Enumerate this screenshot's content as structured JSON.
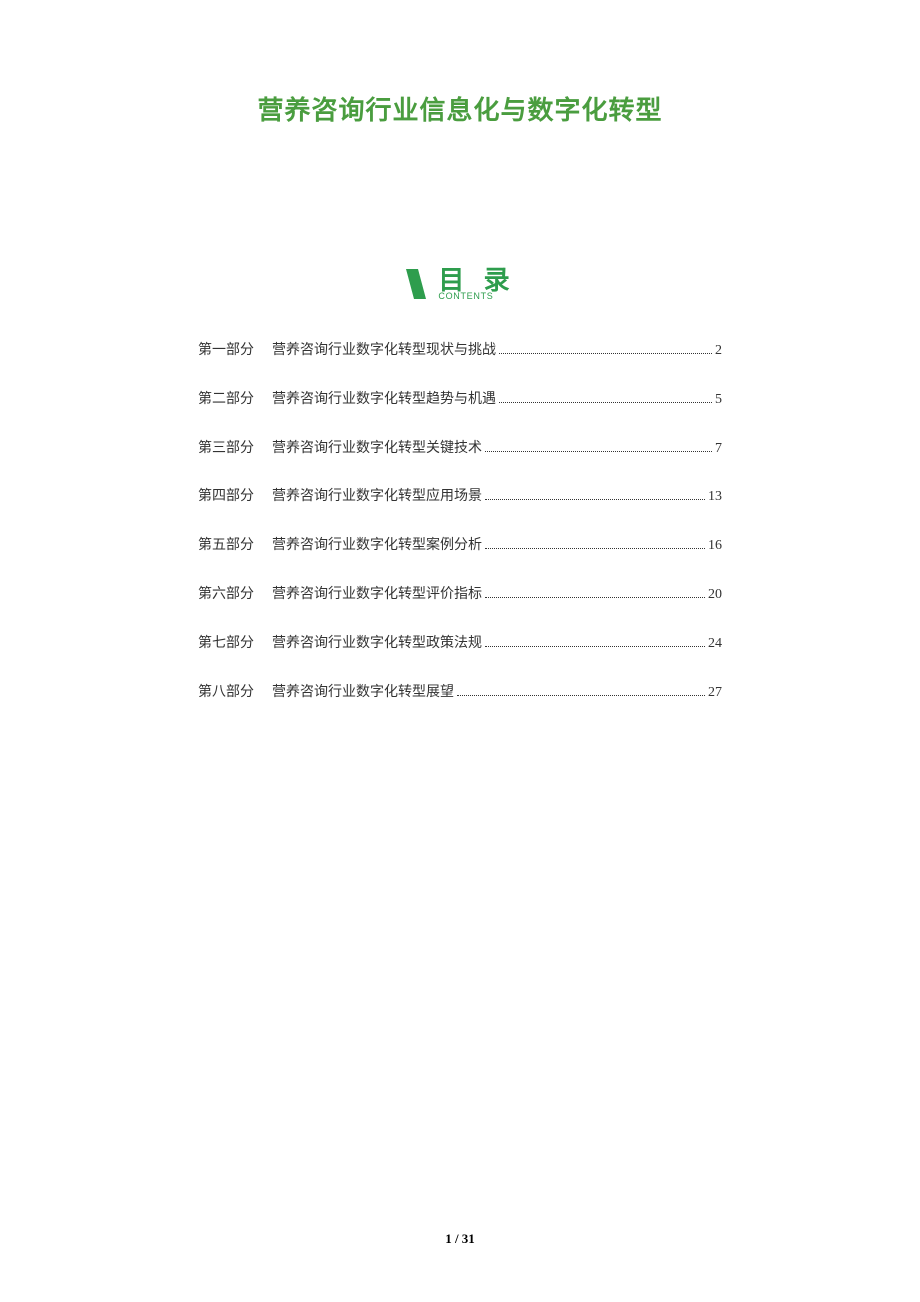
{
  "title": "营养咨询行业信息化与数字化转型",
  "toc": {
    "label": "目 录",
    "sublabel": "CONTENTS",
    "items": [
      {
        "part": "第一部分",
        "title": "营养咨询行业数字化转型现状与挑战",
        "page": "2"
      },
      {
        "part": "第二部分",
        "title": "营养咨询行业数字化转型趋势与机遇",
        "page": "5"
      },
      {
        "part": "第三部分",
        "title": "营养咨询行业数字化转型关键技术",
        "page": "7"
      },
      {
        "part": "第四部分",
        "title": "营养咨询行业数字化转型应用场景",
        "page": "13"
      },
      {
        "part": "第五部分",
        "title": "营养咨询行业数字化转型案例分析",
        "page": "16"
      },
      {
        "part": "第六部分",
        "title": "营养咨询行业数字化转型评价指标",
        "page": "20"
      },
      {
        "part": "第七部分",
        "title": "营养咨询行业数字化转型政策法规",
        "page": "24"
      },
      {
        "part": "第八部分",
        "title": "营养咨询行业数字化转型展望",
        "page": "27"
      }
    ]
  },
  "footer": "1 / 31"
}
